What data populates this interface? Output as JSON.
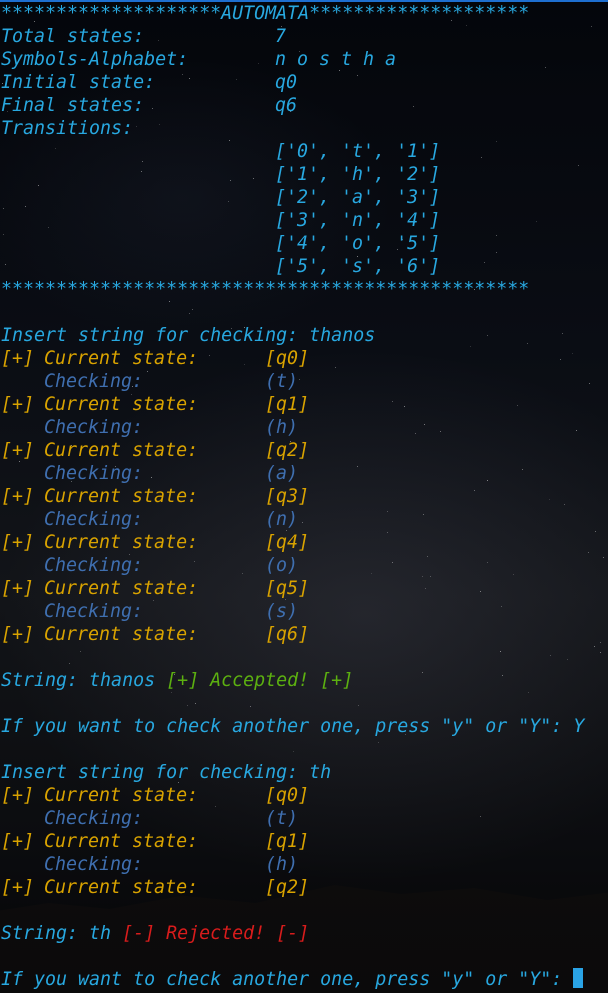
{
  "header": {
    "banner": "********************AUTOMATA********************",
    "total_states_label": "Total states:",
    "total_states_value": "7",
    "alphabet_label": "Symbols-Alphabet:",
    "alphabet_value": "n o s t h a",
    "initial_label": "Initial state:",
    "initial_value": "q0",
    "final_label": "Final states:",
    "final_value": "q6",
    "transitions_label": "Transitions:",
    "transitions": [
      "['0', 't', '1']",
      "['1', 'h', '2']",
      "['2', 'a', '3']",
      "['3', 'n', '4']",
      "['4', 'o', '5']",
      "['5', 's', '6']"
    ],
    "footer_banner": "************************************************"
  },
  "run1": {
    "prompt": "Insert string for checking: thanos",
    "steps": [
      {
        "tag": "[+]",
        "label": "Current state:",
        "state": "[q0]",
        "check_label": "Checking:",
        "symbol": "(t)"
      },
      {
        "tag": "[+]",
        "label": "Current state:",
        "state": "[q1]",
        "check_label": "Checking:",
        "symbol": "(h)"
      },
      {
        "tag": "[+]",
        "label": "Current state:",
        "state": "[q2]",
        "check_label": "Checking:",
        "symbol": "(a)"
      },
      {
        "tag": "[+]",
        "label": "Current state:",
        "state": "[q3]",
        "check_label": "Checking:",
        "symbol": "(n)"
      },
      {
        "tag": "[+]",
        "label": "Current state:",
        "state": "[q4]",
        "check_label": "Checking:",
        "symbol": "(o)"
      },
      {
        "tag": "[+]",
        "label": "Current state:",
        "state": "[q5]",
        "check_label": "Checking:",
        "symbol": "(s)"
      }
    ],
    "last_tag": "[+]",
    "last_label": "Current state:",
    "last_state": "[q6]",
    "result_prefix": "String: thanos ",
    "result_text": "[+] Accepted! [+]",
    "again_prompt": "If you want to check another one, press \"y\" or \"Y\": Y"
  },
  "run2": {
    "prompt": "Insert string for checking: th",
    "steps": [
      {
        "tag": "[+]",
        "label": "Current state:",
        "state": "[q0]",
        "check_label": "Checking:",
        "symbol": "(t)"
      },
      {
        "tag": "[+]",
        "label": "Current state:",
        "state": "[q1]",
        "check_label": "Checking:",
        "symbol": "(h)"
      }
    ],
    "last_tag": "[+]",
    "last_label": "Current state:",
    "last_state": "[q2]",
    "result_prefix": "String: th ",
    "result_text": "[-] Rejected! [-]",
    "again_prompt": "If you want to check another one, press \"y\" or \"Y\": "
  },
  "colors": {
    "info": "#28a8e0",
    "state": "#d9a300",
    "checking": "#3f6fb0",
    "accepted": "#5cb010",
    "rejected": "#d81c1c",
    "cursor": "#2aa3e6"
  }
}
